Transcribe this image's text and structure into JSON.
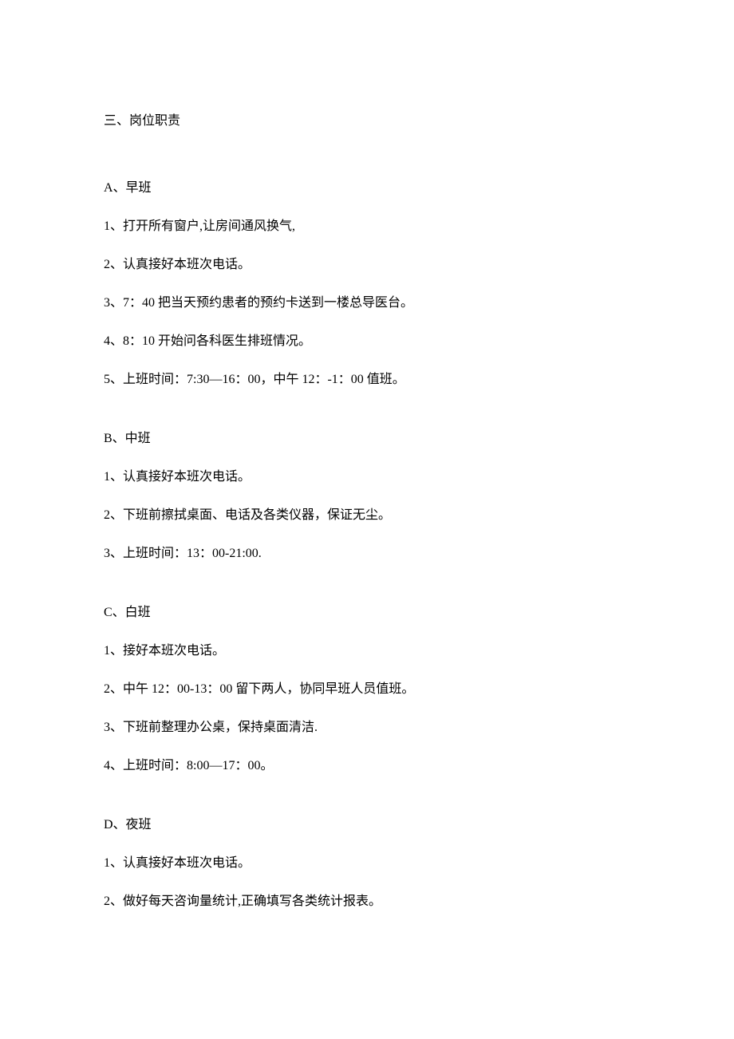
{
  "heading": "三、岗位职责",
  "sections": {
    "a": {
      "title": "A、早班",
      "items": [
        "1、打开所有窗户,让房间通风换气,",
        "2、认真接好本班次电话。",
        "3、7：40 把当天预约患者的预约卡送到一楼总导医台。",
        "4、8：10 开始问各科医生排班情况。",
        "5、上班时间：7:30—16：00，中午 12：-1：00 值班。"
      ]
    },
    "b": {
      "title": "B、中班",
      "items": [
        "1、认真接好本班次电话。",
        "2、下班前擦拭桌面、电话及各类仪器，保证无尘。",
        "3、上班时间：13：00-21:00."
      ]
    },
    "c": {
      "title": "C、白班",
      "items": [
        "1、接好本班次电话。",
        "2、中午 12：00-13：00 留下两人，协同早班人员值班。",
        "3、下班前整理办公桌，保持桌面清洁.",
        "4、上班时间：8:00—17：00。"
      ]
    },
    "d": {
      "title": "D、夜班",
      "items": [
        "1、认真接好本班次电话。",
        "2、做好每天咨询量统计,正确填写各类统计报表。"
      ]
    }
  }
}
